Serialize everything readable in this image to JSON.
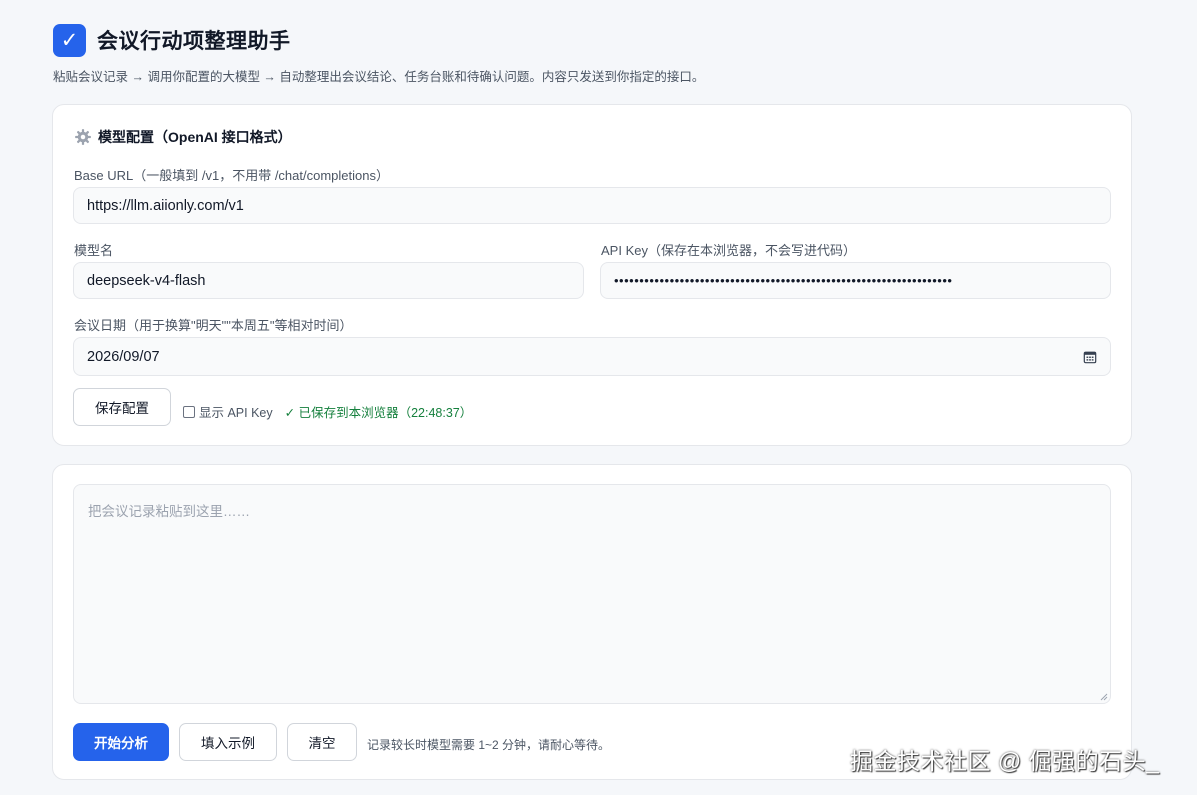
{
  "app": {
    "logo_glyph": "✓",
    "title": "会议行动项整理助手",
    "subtitle": "粘贴会议记录 → 调用你配置的大模型 → 自动整理出会议结论、任务台账和待确认问题。内容只发送到你指定的接口。",
    "accent_color": "#2563eb"
  },
  "config": {
    "section_icon": "gear-icon",
    "section_title": "模型配置（OpenAI 接口格式）",
    "base_url": {
      "label": "Base URL（一般填到 /v1，不用带 /chat/completions）",
      "value": "https://llm.aiionly.com/v1"
    },
    "model": {
      "label": "模型名",
      "value": "deepseek-v4-flash"
    },
    "api_key": {
      "label": "API Key（保存在本浏览器，不会写进代码）",
      "masked_value": "•••••••••••••••••••••••••••••••••••••••••••••••••••••••••••••••••••"
    },
    "meeting_date": {
      "label": "会议日期（用于换算\"明天\"\"本周五\"等相对时间）",
      "value": "2026/09/07",
      "icon": "calendar-icon"
    },
    "save_button": "保存配置",
    "show_key_label": "显示 API Key",
    "show_key_checked": false,
    "saved_status": "✓ 已保存到本浏览器（22:48:37）",
    "status_color": "#15803d"
  },
  "input": {
    "placeholder": "把会议记录粘贴到这里……",
    "value": "",
    "buttons": {
      "analyze": "开始分析",
      "fill_example": "填入示例",
      "clear": "清空"
    },
    "hint": "记录较长时模型需要 1~2 分钟，请耐心等待。"
  },
  "watermark": "掘金技术社区 @ 倔强的石头_"
}
